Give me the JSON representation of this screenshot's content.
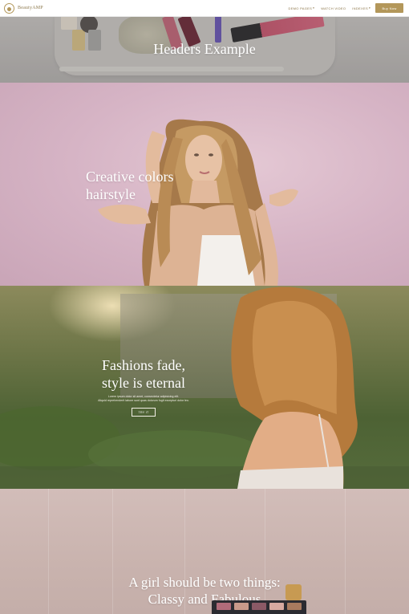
{
  "brand": {
    "name": "BeautyAMP",
    "accent_color": "#b3975a"
  },
  "nav": {
    "items": [
      {
        "label": "DEMO PAGES",
        "has_dropdown": true
      },
      {
        "label": "WATCH VIDEO",
        "has_dropdown": false
      },
      {
        "label": "INDEXES",
        "has_dropdown": true
      }
    ],
    "buy_label": "Buy Now"
  },
  "sections": [
    {
      "title": "Headers Example"
    },
    {
      "title_line1": "Creative colors",
      "title_line2": "hairstyle"
    },
    {
      "title_line1": "Fashions fade,",
      "title_line2": "style is eternal",
      "body_line1": "Lorem ipsum dolor sit amet, consectetur adipisicing elit.",
      "body_line2": "Aliquid reprehenderit labore sunt quas dolorum fugit excepturi dolor leo.",
      "button_label": "TRY IT"
    },
    {
      "title_line1": "A girl should be two things:",
      "title_line2": "Classy and Fabulous"
    }
  ],
  "icons": [
    "logo-icon",
    "chevron-down-icon"
  ]
}
